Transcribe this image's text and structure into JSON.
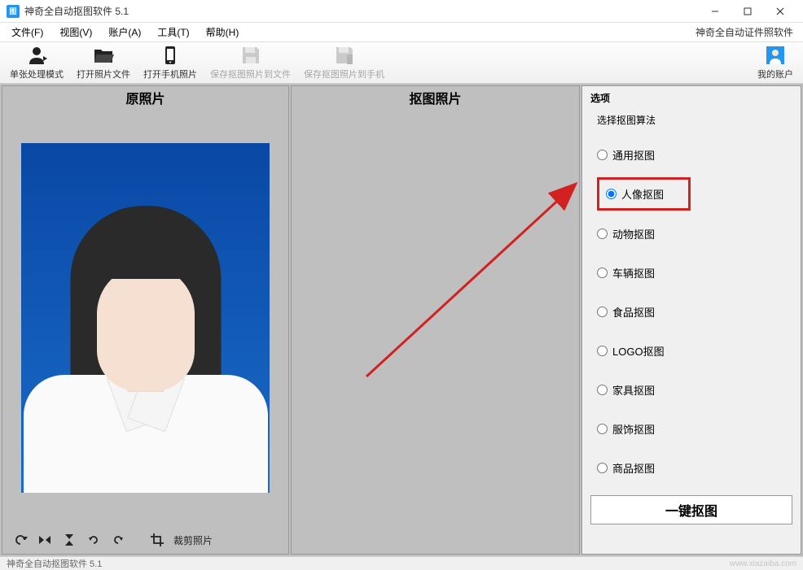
{
  "titlebar": {
    "app_icon": "图",
    "title": "神奇全自动抠图软件 5.1"
  },
  "menubar": {
    "items": [
      "文件(F)",
      "视图(V)",
      "账户(A)",
      "工具(T)",
      "帮助(H)"
    ],
    "promo": "神奇全自动证件照软件"
  },
  "toolbar": {
    "items": [
      {
        "label": "单张处理模式",
        "icon": "person"
      },
      {
        "label": "打开照片文件",
        "icon": "folder"
      },
      {
        "label": "打开手机照片",
        "icon": "phone"
      },
      {
        "label": "保存抠图照片到文件",
        "icon": "save-file",
        "disabled": true
      },
      {
        "label": "保存抠图照片到手机",
        "icon": "save-phone",
        "disabled": true
      }
    ],
    "account": "我的账户"
  },
  "panels": {
    "left_title": "原照片",
    "center_title": "抠图照片",
    "right_title": "选项",
    "algorithm_label": "选择抠图算法"
  },
  "photo_tools": {
    "crop_label": "裁剪照片"
  },
  "radios": [
    {
      "label": "通用抠图",
      "checked": false
    },
    {
      "label": "人像抠图",
      "checked": true,
      "highlighted": true
    },
    {
      "label": "动物抠图",
      "checked": false
    },
    {
      "label": "车辆抠图",
      "checked": false
    },
    {
      "label": "食品抠图",
      "checked": false
    },
    {
      "label": "LOGO抠图",
      "checked": false
    },
    {
      "label": "家具抠图",
      "checked": false
    },
    {
      "label": "服饰抠图",
      "checked": false
    },
    {
      "label": "商品抠图",
      "checked": false
    }
  ],
  "action_button": "一键抠图",
  "statusbar": {
    "text": "神奇全自动抠图软件 5.1",
    "watermark": "www.xiazaiba.com"
  }
}
